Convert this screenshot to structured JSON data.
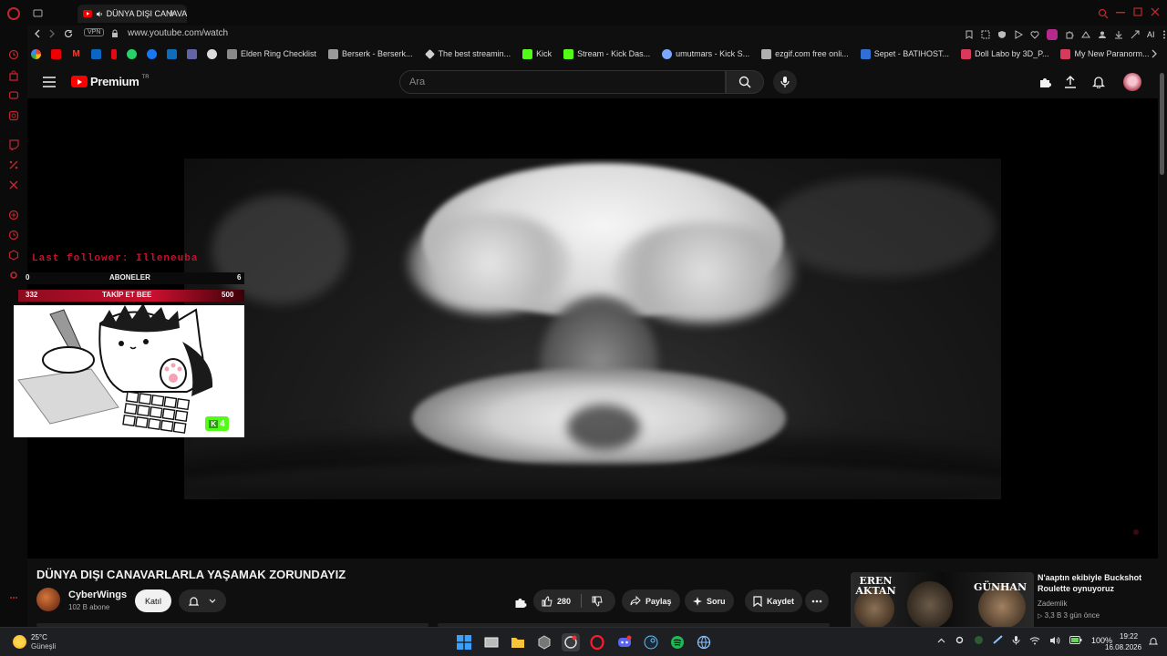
{
  "browser": {
    "active_tab_title": "DÜNYA DIŞI CANAVARL",
    "new_tab_label": "+",
    "vpn_label": "VPN",
    "url": "www.youtube.com/watch",
    "ai_label": "AI"
  },
  "bookmarks": [
    {
      "label": "Elden Ring Checklist",
      "icon": "elden-ring-icon",
      "color": "#8a8a8a"
    },
    {
      "label": "Berserk - Berserk...",
      "icon": "berserk-icon",
      "color": "#9a9a9a"
    },
    {
      "label": "The best streamin...",
      "icon": "diamond-icon",
      "color": "#cfcfcf"
    },
    {
      "label": "Kick",
      "icon": "kick-icon",
      "color": "#53fc18"
    },
    {
      "label": "Stream - Kick Das...",
      "icon": "kick-icon",
      "color": "#53fc18"
    },
    {
      "label": "umutmars - Kick S...",
      "icon": "link-icon",
      "color": "#7aa7ff"
    },
    {
      "label": "ezgif.com free onli...",
      "icon": "ezgif-icon",
      "color": "#b0b0b0"
    },
    {
      "label": "Sepet - BATIHOST...",
      "icon": "batihost-icon",
      "color": "#2f6fd6"
    },
    {
      "label": "Doll Labo by 3D_P...",
      "icon": "doll-labo-icon",
      "color": "#d83a5c"
    },
    {
      "label": "My New Paranorm...",
      "icon": "paranormal-icon",
      "color": "#d83a5c"
    }
  ],
  "youtube": {
    "logo_text": "Premium",
    "region": "TR",
    "search_placeholder": "Ara"
  },
  "overlay": {
    "last_follower": "Last follower: Illeneuba",
    "bar1_left": "0",
    "bar1_label": "ABONELER",
    "bar1_right": "6",
    "bar2_left": "332",
    "bar2_label": "TAKİP ET BEE",
    "bar2_right": "500",
    "kick_count": "4",
    "keyboard_text": "KBTYK OAYLEX OOPQSK"
  },
  "video": {
    "title": "DÜNYA DIŞI CANAVARLARLA YAŞAMAK ZORUNDAYIZ",
    "channel": "CyberWings",
    "subscribers": "102 B abone",
    "join_label": "Katıl",
    "likes": "280",
    "share_label": "Paylaş",
    "ask_label": "Soru",
    "save_label": "Kaydet"
  },
  "recommendation": {
    "title": "N'aaptın ekibiyle Buckshot Roulette oynuyoruz",
    "channel": "Zademlik",
    "meta": "3,3 B   3 gün önce",
    "thumb_left_text": "EREN AKTAN",
    "thumb_right_text": "GÜNHAN"
  },
  "taskbar": {
    "temperature": "25°C",
    "condition": "Güneşli",
    "battery": "100%",
    "time": "19:22",
    "date": "16.08.2026"
  },
  "colors": {
    "youtube_red": "#ff0000",
    "opera_red": "#c0272d",
    "kick_green": "#53fc18",
    "overlay_red": "#c8102e"
  }
}
